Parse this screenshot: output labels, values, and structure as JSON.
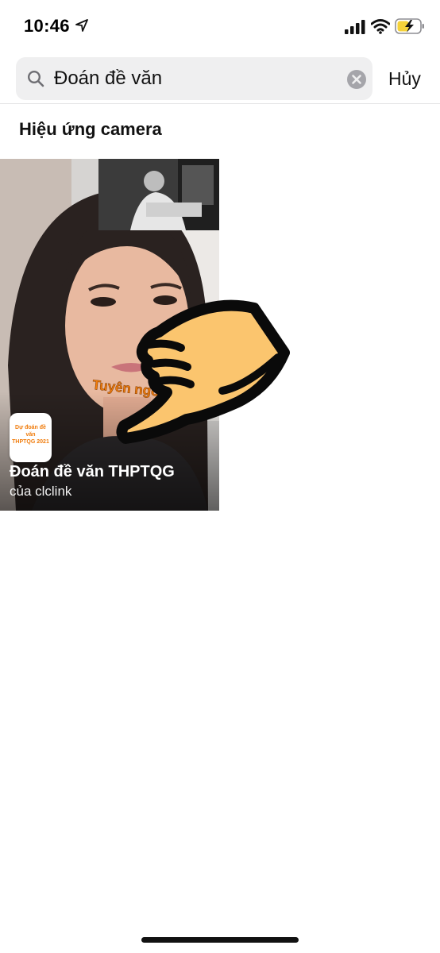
{
  "status_bar": {
    "time": "10:46",
    "icons": [
      "location-arrow-icon",
      "cellular-signal-icon",
      "wifi-icon",
      "battery-charging-icon"
    ],
    "battery_color": "#f5d23a"
  },
  "search": {
    "query": "Đoán đề văn",
    "cancel_label": "Hủy"
  },
  "section": {
    "title": "Hiệu ứng camera"
  },
  "effect": {
    "name": "Đoán đề văn THPTQG",
    "author": "của clclink",
    "overlay_caption": "Tuyên ngôn độc lập",
    "icon_text_line1": "Dự đoán đề văn",
    "icon_text_line2": "THPTQG 2021",
    "accent_color": "#f07b0a"
  },
  "overlay": {
    "icon": "hand-pointer-icon",
    "color": "#fbc56e"
  }
}
